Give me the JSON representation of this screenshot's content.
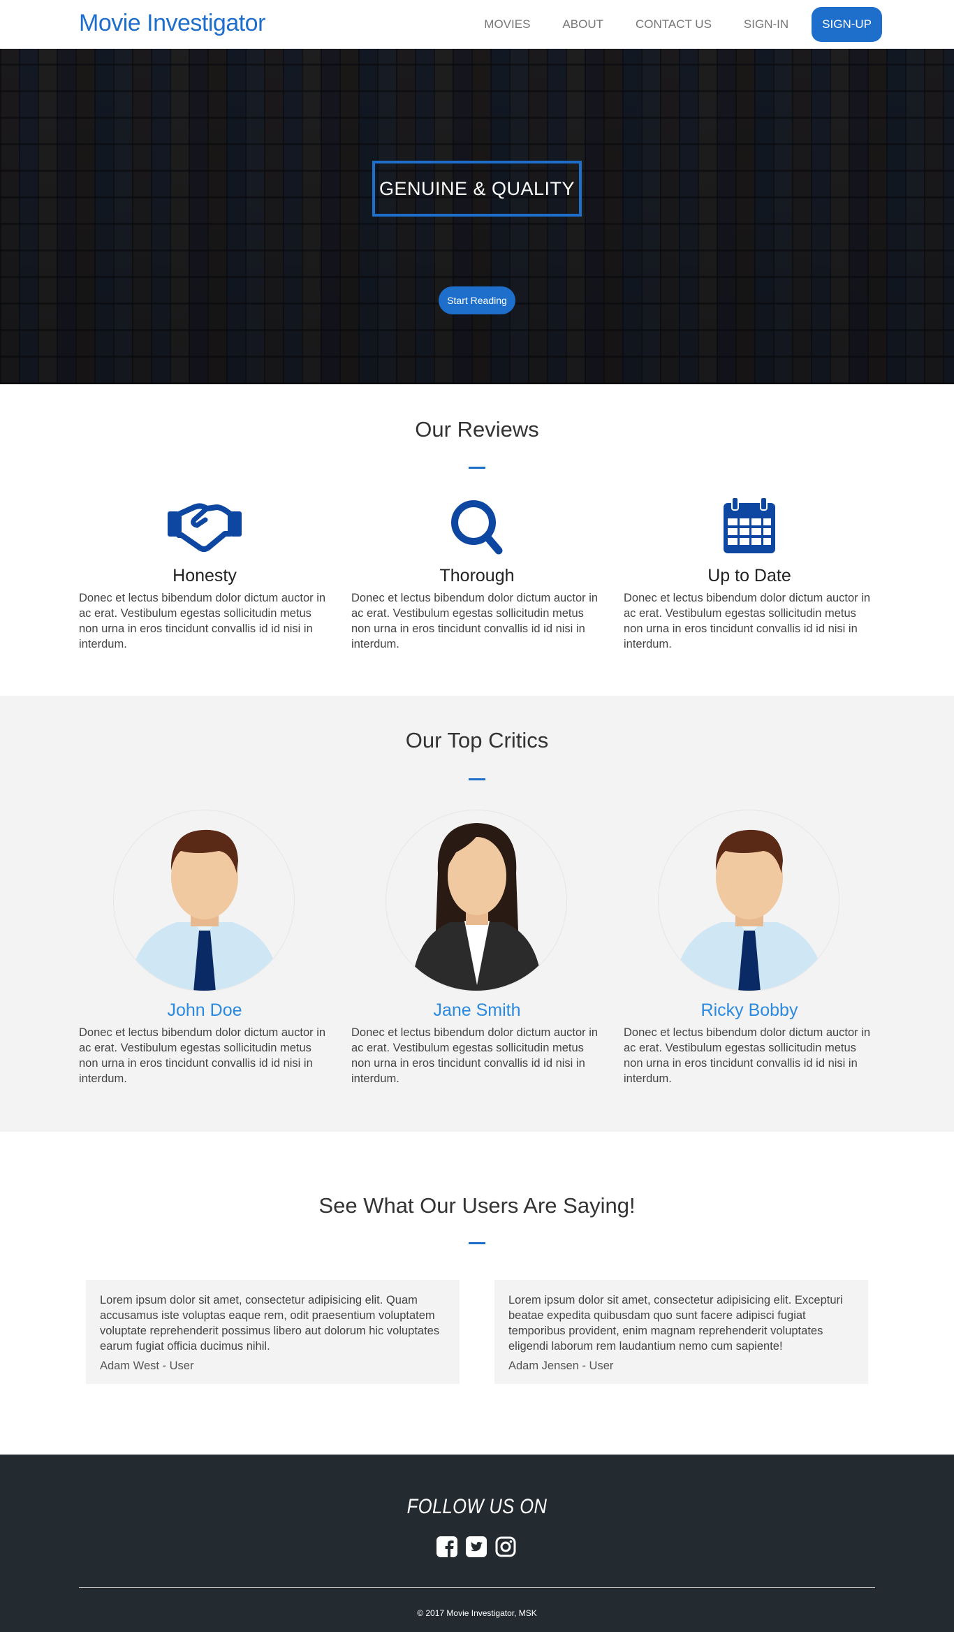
{
  "nav": {
    "brand": "Movie Investigator",
    "links": [
      "MOVIES",
      "ABOUT",
      "CONTACT US",
      "SIGN-IN"
    ],
    "signup": "SIGN-UP"
  },
  "hero": {
    "badge": "GENUINE & QUALITY",
    "button": "Start Reading"
  },
  "reviews": {
    "title": "Our Reviews",
    "items": [
      {
        "icon": "handshake-icon",
        "title": "Honesty",
        "text": "Donec et lectus bibendum dolor dictum auctor in ac erat. Vestibulum egestas sollicitudin metus non urna in eros tincidunt convallis id id nisi in interdum."
      },
      {
        "icon": "search-icon",
        "title": "Thorough",
        "text": "Donec et lectus bibendum dolor dictum auctor in ac erat. Vestibulum egestas sollicitudin metus non urna in eros tincidunt convallis id id nisi in interdum."
      },
      {
        "icon": "calendar-icon",
        "title": "Up to Date",
        "text": "Donec et lectus bibendum dolor dictum auctor in ac erat. Vestibulum egestas sollicitudin metus non urna in eros tincidunt convallis id id nisi in interdum."
      }
    ]
  },
  "critics": {
    "title": "Our Top Critics",
    "items": [
      {
        "avatar": "male-avatar",
        "name": "John Doe",
        "text": "Donec et lectus bibendum dolor dictum auctor in ac erat. Vestibulum egestas sollicitudin metus non urna in eros tincidunt convallis id id nisi in interdum."
      },
      {
        "avatar": "female-avatar",
        "name": "Jane Smith",
        "text": "Donec et lectus bibendum dolor dictum auctor in ac erat. Vestibulum egestas sollicitudin metus non urna in eros tincidunt convallis id id nisi in interdum."
      },
      {
        "avatar": "male-avatar",
        "name": "Ricky Bobby",
        "text": "Donec et lectus bibendum dolor dictum auctor in ac erat. Vestibulum egestas sollicitudin metus non urna in eros tincidunt convallis id id nisi in interdum."
      }
    ]
  },
  "testimonials": {
    "title": "See What Our Users Are Saying!",
    "items": [
      {
        "text": "Lorem ipsum dolor sit amet, consectetur adipisicing elit. Quam accusamus iste voluptas eaque rem, odit praesentium voluptatem voluptate reprehenderit possimus libero aut dolorum hic voluptates earum fugiat officia ducimus nihil.",
        "author": "Adam West - User"
      },
      {
        "text": "Lorem ipsum dolor sit amet, consectetur adipisicing elit. Excepturi beatae expedita quibusdam quo sunt facere adipisci fugiat temporibus provident, enim magnam reprehenderit voluptates eligendi laborum rem laudantium nemo cum sapiente!",
        "author": "Adam Jensen - User"
      }
    ]
  },
  "footer": {
    "follow": "FOLLOW US ON",
    "social": [
      "facebook-icon",
      "twitter-icon",
      "instagram-icon"
    ],
    "copyright": "© 2017 Movie Investigator, MSK"
  },
  "colors": {
    "accent": "#1e6fcc",
    "icon_blue": "#0d47a1",
    "critic_name": "#2b8ae0",
    "footer_bg": "#232a30",
    "section_gray": "#f3f3f3"
  }
}
